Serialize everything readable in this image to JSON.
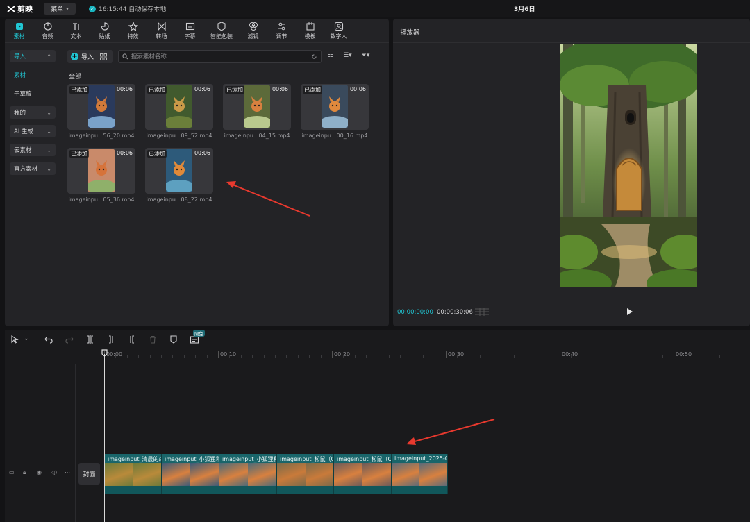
{
  "app": {
    "name": "剪映",
    "menu_label": "菜单",
    "save_status": "16:15:44 自动保存本地",
    "project_title": "3月6日"
  },
  "toolbar": {
    "tabs": [
      {
        "label": "素材",
        "icon": "media-icon",
        "active": true
      },
      {
        "label": "音频",
        "icon": "audio-icon"
      },
      {
        "label": "文本",
        "icon": "text-icon"
      },
      {
        "label": "贴纸",
        "icon": "sticker-icon"
      },
      {
        "label": "特效",
        "icon": "effects-icon"
      },
      {
        "label": "转场",
        "icon": "transition-icon"
      },
      {
        "label": "字幕",
        "icon": "subtitle-icon"
      },
      {
        "label": "智能包装",
        "icon": "smart-pack-icon"
      },
      {
        "label": "滤镜",
        "icon": "filter-icon"
      },
      {
        "label": "调节",
        "icon": "adjust-icon"
      },
      {
        "label": "模板",
        "icon": "template-icon"
      },
      {
        "label": "数字人",
        "icon": "digital-human-icon"
      }
    ]
  },
  "side_nav": {
    "import": "导入",
    "material": "素材",
    "sub_draft": "子草稿",
    "mine": "我的",
    "ai_gen": "AI 生成",
    "cloud": "云素材",
    "official": "官方素材"
  },
  "media": {
    "import_label": "导入",
    "search_placeholder": "搜索素材名称",
    "section_label": "全部",
    "added_badge": "已添加",
    "items": [
      {
        "name": "imageinpu...56_20.mp4",
        "duration": "00:06"
      },
      {
        "name": "imageinpu...09_52.mp4",
        "duration": "00:06"
      },
      {
        "name": "imageinpu...04_15.mp4",
        "duration": "00:06"
      },
      {
        "name": "imageinpu...00_16.mp4",
        "duration": "00:06"
      },
      {
        "name": "imageinpu...05_36.mp4",
        "duration": "00:06"
      },
      {
        "name": "imageinpu...08_22.mp4",
        "duration": "00:06"
      }
    ]
  },
  "player": {
    "title": "播放器",
    "current_time": "00:00:00:00",
    "total_time": "00:00:30:06"
  },
  "timeline": {
    "badge": "限免",
    "ruler": [
      "00:00",
      "00:10",
      "00:20",
      "00:30",
      "00:40",
      "00:50"
    ],
    "cover_label": "封面",
    "clips": [
      {
        "label": "imageinput_清晨的森"
      },
      {
        "label": "imageinput_小狐狸和"
      },
      {
        "label": "imageinput_小狐狸和"
      },
      {
        "label": "imageinput_松鼠（C"
      },
      {
        "label": "imageinput_松鼠（C"
      },
      {
        "label": "imageinput_2025-0"
      }
    ]
  },
  "colors": {
    "accent": "#21c6d3",
    "clip": "#19656a",
    "panel": "#232326",
    "annotation_arrow": "#e8392e"
  }
}
